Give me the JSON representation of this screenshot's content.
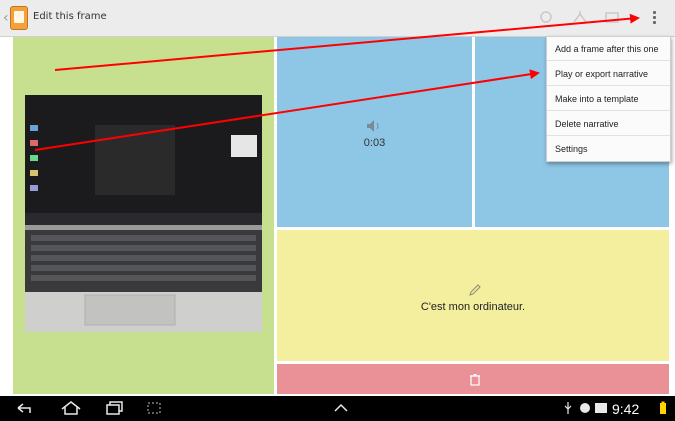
{
  "header": {
    "title": "Edit this frame"
  },
  "frame": {
    "audio_duration": "0:03",
    "narration_text": "C'est mon ordinateur."
  },
  "menu": {
    "items": [
      {
        "label": "Add a frame after this one"
      },
      {
        "label": "Play or export narrative"
      },
      {
        "label": "Make into a template"
      },
      {
        "label": "Delete narrative"
      },
      {
        "label": "Settings"
      }
    ]
  },
  "status_bar": {
    "time": "9:42"
  },
  "colors": {
    "image_panel": "#c6e08f",
    "audio_panel": "#8ec6e6",
    "text_panel": "#f3ef9e",
    "delete_bar": "#ea9197",
    "annotation_arrows": "#ff0000"
  },
  "icons": [
    "back-icon",
    "app-icon",
    "share-icon",
    "overflow-menu-icon",
    "speaker-icon",
    "pencil-icon",
    "trash-icon",
    "nav-back-icon",
    "nav-home-icon",
    "nav-recents-icon",
    "screenshot-icon",
    "nav-up-icon",
    "usb-icon",
    "notification-icon",
    "battery-icon"
  ]
}
